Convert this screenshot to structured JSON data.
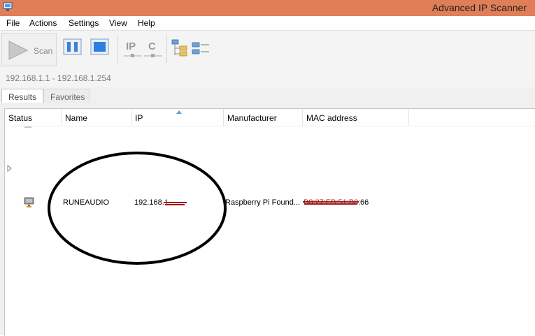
{
  "window": {
    "title": "Advanced IP Scanner"
  },
  "menu": [
    "File",
    "Actions",
    "Settings",
    "View",
    "Help"
  ],
  "toolbar": {
    "scan_label": "Scan",
    "ip_icon_label": "IP",
    "c_icon_label": "C"
  },
  "ip_range": {
    "value": "192.168.1.1 - 192.168.1.254"
  },
  "tabs": [
    {
      "label": "Results",
      "active": true
    },
    {
      "label": "Favorites",
      "active": false
    }
  ],
  "columns": [
    "Status",
    "Name",
    "IP",
    "Manufacturer",
    "MAC address"
  ],
  "rows": [
    {
      "status_icon": "computer-icon",
      "name": "RUNEAUDIO",
      "ip_visible": "192.168.",
      "ip_redacted": "1···",
      "manufacturer": "Raspberry Pi Found...",
      "mac_redacted": "B8:27:EB:51:B0:",
      "mac_visible": "66"
    }
  ],
  "colors": {
    "titlebar": "#e07e58",
    "redaction": "#a01818",
    "annotation": "#000000"
  }
}
